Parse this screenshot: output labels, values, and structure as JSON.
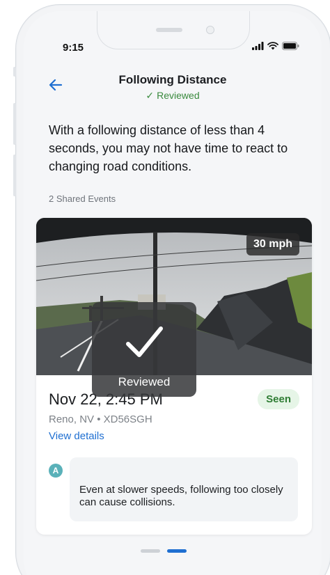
{
  "status_bar": {
    "time": "9:15",
    "icons": [
      "signal-icon",
      "wifi-icon",
      "battery-icon"
    ]
  },
  "header": {
    "back_icon": "arrow-left-icon",
    "title": "Following Distance",
    "status_check": "✓",
    "status": "Reviewed"
  },
  "description": "With a following distance of less than 4 seconds, you may not have time to react to changing road conditions.",
  "shared_events_label": "2 Shared Events",
  "event": {
    "speed": "30 mph",
    "date": "Nov 22, 2:45 PM",
    "seen_badge": "Seen",
    "location": "Reno, NV • XD56SGH",
    "view_details": "View details",
    "comment": {
      "avatar_initial": "A",
      "text": "Even at slower speeds, following too closely can cause collisions."
    }
  },
  "overlay": {
    "icon": "checkmark-icon",
    "label": "Reviewed"
  },
  "pager": {
    "pages": 2,
    "active": 1
  },
  "colors": {
    "accent": "#1f6fd1",
    "reviewed_green": "#3a8a3e",
    "seen_bg": "#e6f5e7",
    "avatar": "#5ab1b9",
    "pager_active": "#1f6fd1",
    "pager_inactive": "#cdd1d6"
  }
}
